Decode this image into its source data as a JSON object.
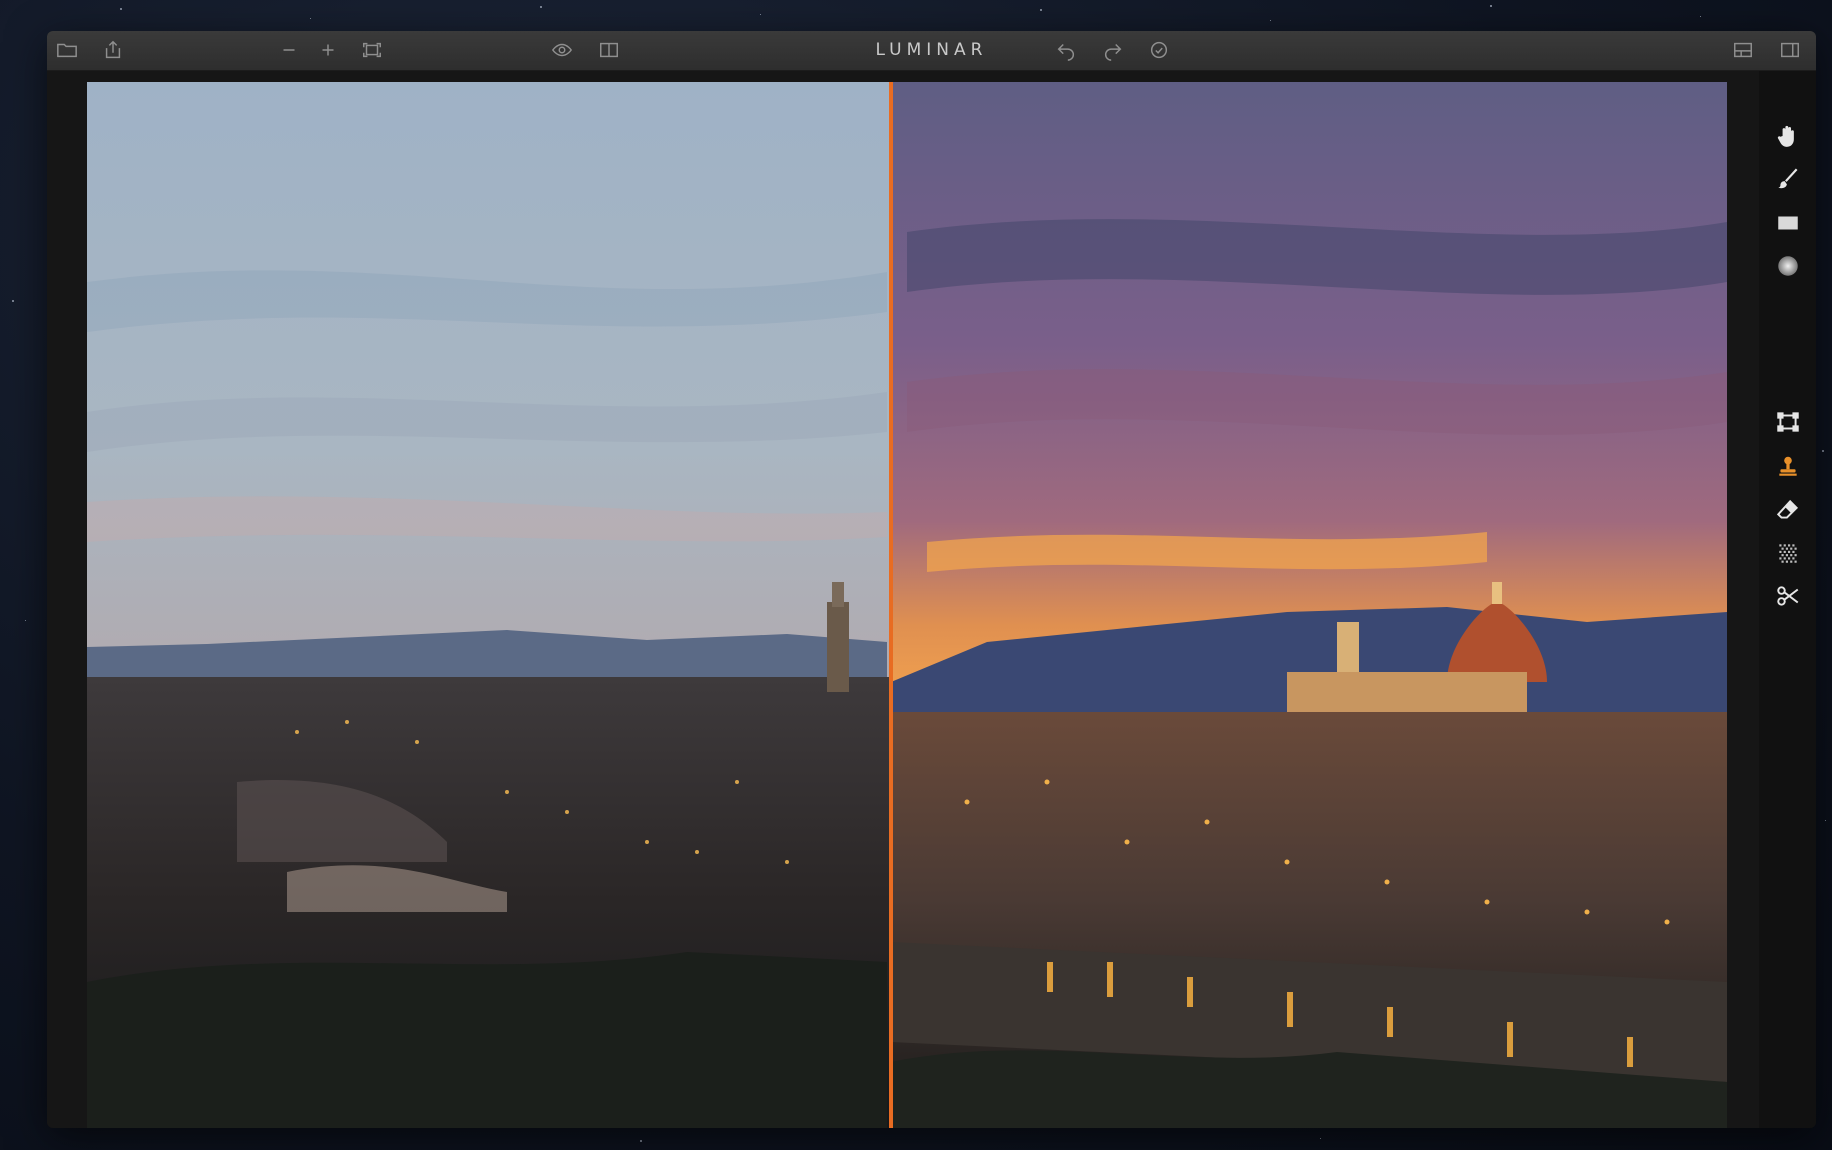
{
  "app": {
    "title": "LUMINAR"
  },
  "colors": {
    "accent": "#e86c22",
    "toolbar": "#333333",
    "icon": "#8f8f8f",
    "active_tool": "#e8902a"
  },
  "toolbar": {
    "left": [
      "folder-icon",
      "share-icon"
    ],
    "zoom": [
      "zoom-out-icon",
      "zoom-in-icon",
      "fit-screen-icon"
    ],
    "view": [
      "eye-icon",
      "split-view-icon"
    ],
    "history": [
      "undo-icon",
      "redo-icon",
      "history-icon"
    ],
    "right": [
      "layout-icon",
      "panel-toggle-icon"
    ]
  },
  "tools": [
    "hand-icon",
    "brush-icon",
    "gradient-icon",
    "radial-icon",
    "crop-icon",
    "stamp-icon",
    "erase-icon",
    "noise-icon",
    "cut-icon"
  ],
  "active_tool": "stamp-icon",
  "compare": {
    "mode": "split",
    "divider_position": 0.49
  }
}
